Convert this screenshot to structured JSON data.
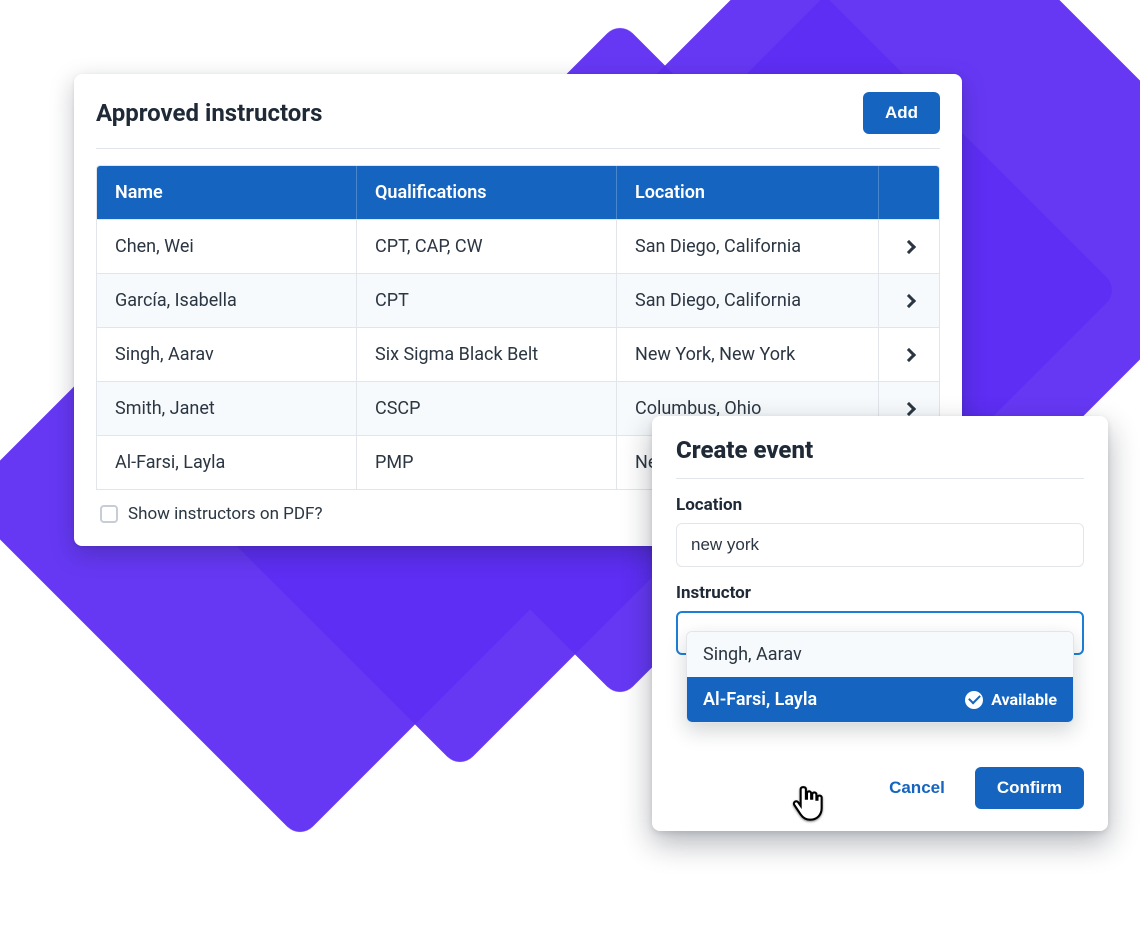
{
  "panel": {
    "title": "Approved instructors",
    "add_label": "Add",
    "columns": {
      "name": "Name",
      "qual": "Qualifications",
      "loc": "Location"
    },
    "rows": [
      {
        "name": "Chen, Wei",
        "qual": "CPT, CAP, CW",
        "loc": "San Diego, California"
      },
      {
        "name": "García, Isabella",
        "qual": "CPT",
        "loc": "San Diego, California"
      },
      {
        "name": "Singh, Aarav",
        "qual": "Six Sigma Black Belt",
        "loc": "New York, New York"
      },
      {
        "name": "Smith, Janet",
        "qual": "CSCP",
        "loc": "Columbus, Ohio"
      },
      {
        "name": "Al-Farsi, Layla",
        "qual": "PMP",
        "loc": "New York, New York"
      }
    ],
    "pdf_checkbox_label": "Show instructors on PDF?"
  },
  "modal": {
    "title": "Create event",
    "location_label": "Location",
    "location_value": "new york",
    "instructor_label": "Instructor",
    "instructor_value": "",
    "options": [
      {
        "label": "Singh, Aarav",
        "selected": false
      },
      {
        "label": "Al-Farsi, Layla",
        "selected": true,
        "status": "Available"
      }
    ],
    "cancel_label": "Cancel",
    "confirm_label": "Confirm"
  }
}
